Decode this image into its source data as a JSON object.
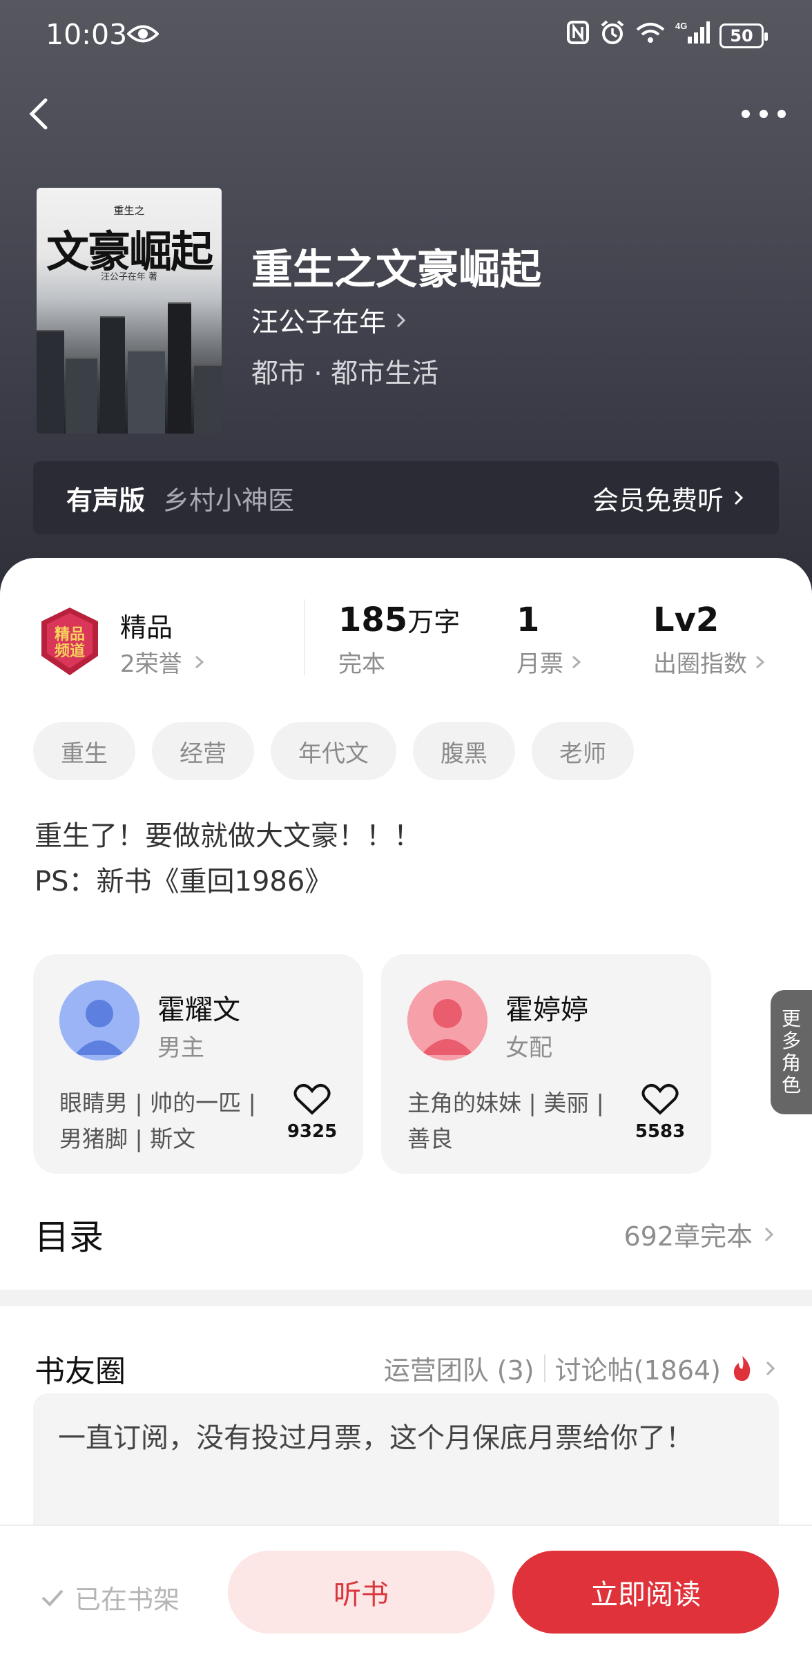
{
  "status_bar": {
    "time": "10:03",
    "battery": "50"
  },
  "book": {
    "title": "重生之文豪崛起",
    "author": "汪公子在年",
    "genre": "都市 · 都市生活",
    "cover": {
      "small_text": "重生之",
      "title": "文豪崛起",
      "author": "汪公子在年 著"
    }
  },
  "audio": {
    "label": "有声版",
    "title": "乡村小神医",
    "cta": "会员免费听"
  },
  "honor": {
    "title": "精品",
    "subtitle": "2荣誉",
    "badge_text": "精品频道"
  },
  "stats": {
    "words": {
      "value": "185",
      "unit": "万字",
      "label": "完本"
    },
    "monthly": {
      "value": "1",
      "label": "月票"
    },
    "level": {
      "value": "Lv2",
      "label": "出圈指数"
    }
  },
  "tags": [
    "重生",
    "经营",
    "年代文",
    "腹黑",
    "老师"
  ],
  "intro": {
    "line1": "重生了！要做就做大文豪！！！",
    "line2": "PS：新书《重回1986》"
  },
  "characters": [
    {
      "name": "霍耀文",
      "role": "男主",
      "desc": "眼睛男 | 帅的一匹 | 男猪脚 | 斯文",
      "likes": "9325",
      "avatar_color": "#8eaaf3"
    },
    {
      "name": "霍婷婷",
      "role": "女配",
      "desc": "主角的妹妹 | 美丽 | 善良",
      "likes": "5583",
      "avatar_color": "#f58a96"
    }
  ],
  "more_roles": [
    "更",
    "多",
    "角",
    "色"
  ],
  "toc": {
    "title": "目录",
    "summary": "692章完本"
  },
  "circle": {
    "title": "书友圈",
    "team": "运营团队 (3)",
    "posts_count": "讨论帖(1864)",
    "post_text": "一直订阅，没有投过月票，这个月保底月票给你了！"
  },
  "bottom": {
    "shelf": "已在书架",
    "listen": "听书",
    "read": "立即阅读"
  },
  "colors": {
    "accent": "#e0323a",
    "accent_light": "#fce6e6",
    "hero_dark": "#2f3039"
  }
}
